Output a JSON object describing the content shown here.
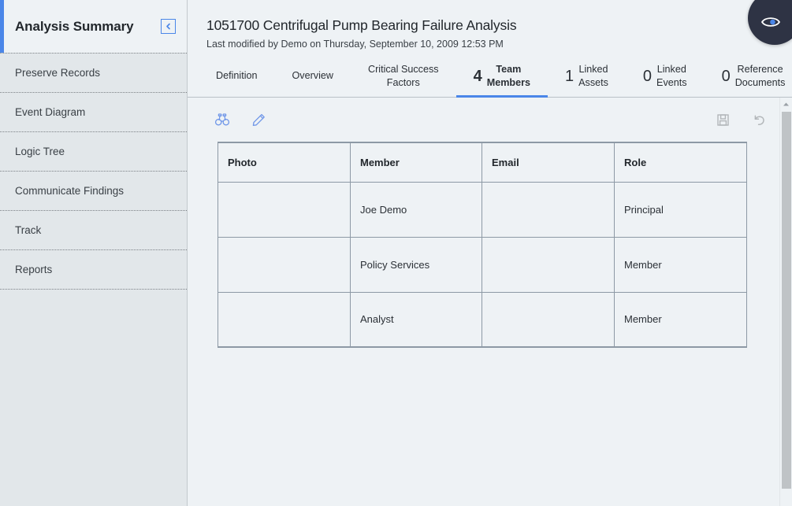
{
  "sidebar": {
    "title": "Analysis Summary",
    "collapse_button_label": "Collapse navigation",
    "items": [
      {
        "label": "Preserve Records"
      },
      {
        "label": "Event Diagram"
      },
      {
        "label": "Logic Tree"
      },
      {
        "label": "Communicate Findings"
      },
      {
        "label": "Track"
      },
      {
        "label": "Reports"
      }
    ]
  },
  "header": {
    "title": "1051700 Centrifugal Pump Bearing Failure Analysis",
    "subtitle": "Last modified by Demo on Thursday, September 10, 2009 12:53 PM"
  },
  "tabs": [
    {
      "count": "",
      "line1": "Definition",
      "line2": "",
      "active": false
    },
    {
      "count": "",
      "line1": "Overview",
      "line2": "",
      "active": false
    },
    {
      "count": "",
      "line1": "Critical Success",
      "line2": "Factors",
      "active": false
    },
    {
      "count": "4",
      "line1": "Team",
      "line2": "Members",
      "active": true
    },
    {
      "count": "1",
      "line1": "Linked",
      "line2": "Assets",
      "active": false
    },
    {
      "count": "0",
      "line1": "Linked",
      "line2": "Events",
      "active": false
    },
    {
      "count": "0",
      "line1": "Reference",
      "line2": "Documents",
      "active": false
    }
  ],
  "toolbar": {
    "find_label": "Find",
    "edit_label": "Edit",
    "save_label": "Save",
    "undo_label": "Undo"
  },
  "table": {
    "columns": [
      "Photo",
      "Member",
      "Email",
      "Role"
    ],
    "rows": [
      {
        "photo": "",
        "member": "Joe Demo",
        "email": "",
        "role": "Principal"
      },
      {
        "photo": "",
        "member": "Policy Services",
        "email": "",
        "role": "Member"
      },
      {
        "photo": "",
        "member": "Analyst",
        "email": "",
        "role": "Member"
      }
    ]
  },
  "fab": {
    "label": "Help / Assistant"
  },
  "colors": {
    "accent": "#4a86e8",
    "sidebar_bg": "#e2e7ea",
    "content_bg": "#eef2f5",
    "fab_bg": "#2e3344",
    "table_border": "#8d99a5"
  }
}
